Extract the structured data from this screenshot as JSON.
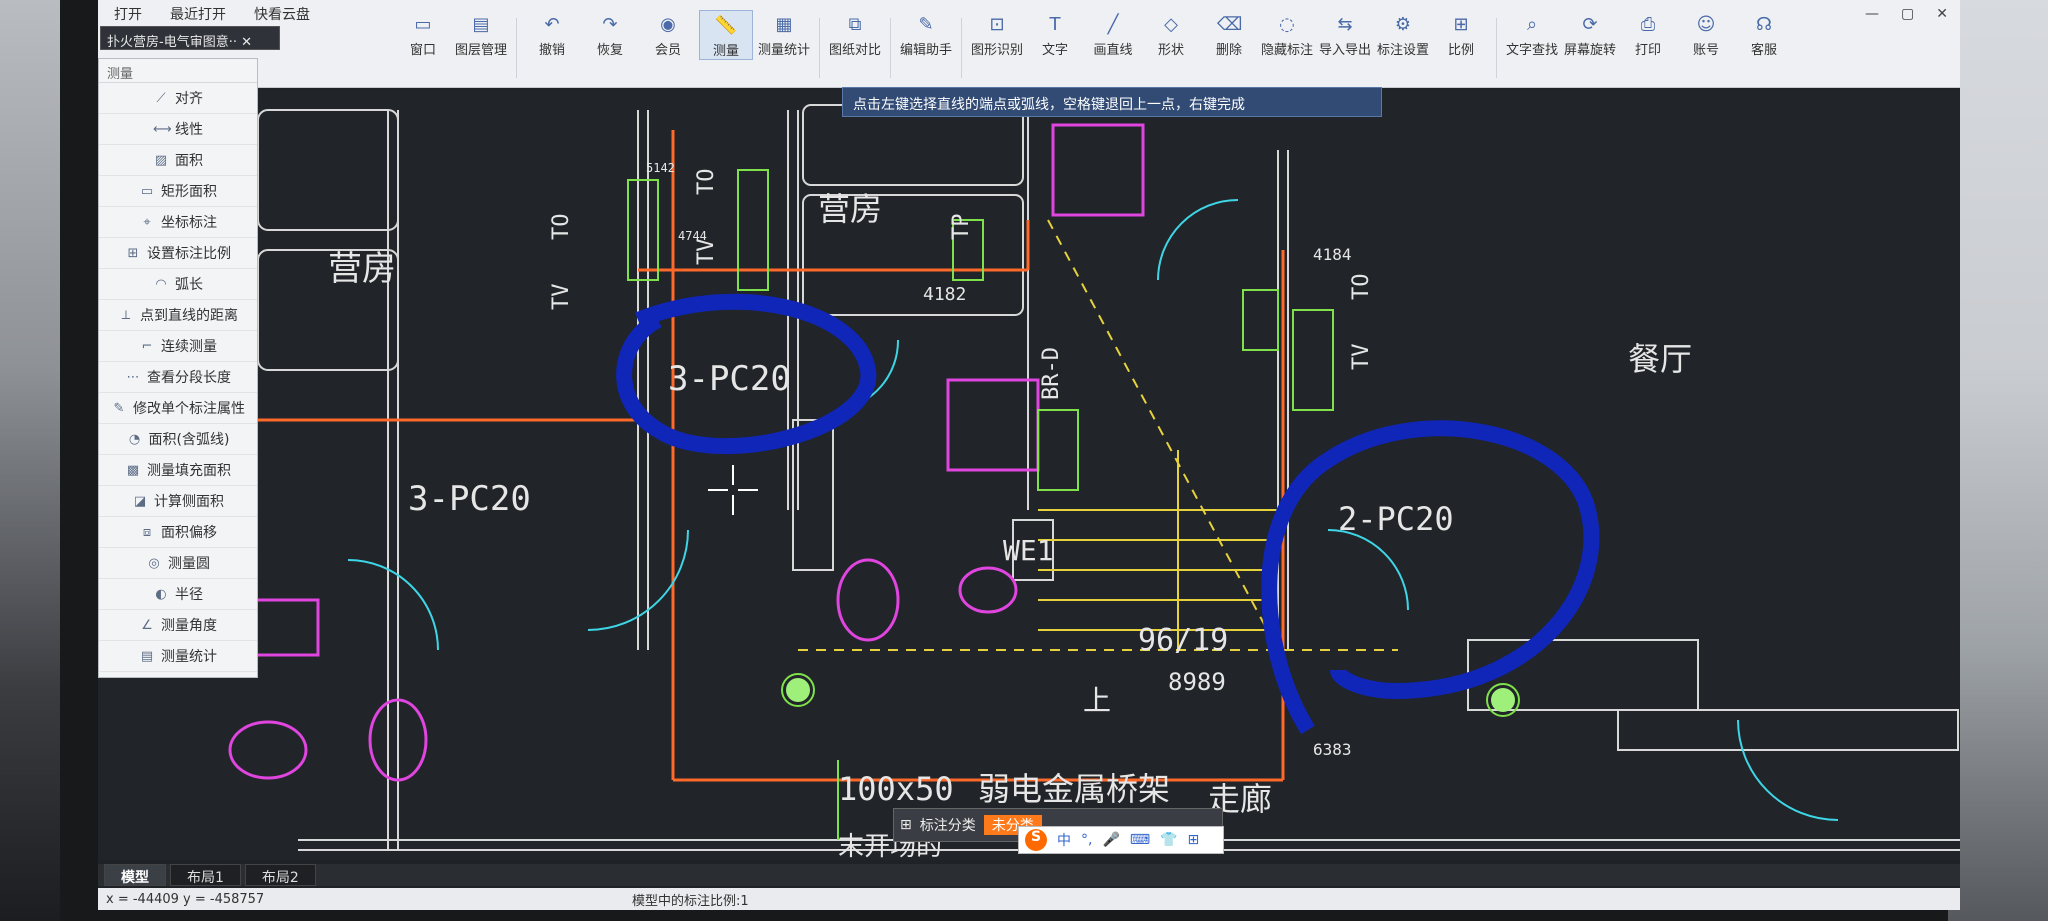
{
  "top_menu": [
    "打开",
    "最近打开",
    "快看云盘"
  ],
  "ribbon_buttons": [
    {
      "label": "窗口",
      "icon": "window-icon"
    },
    {
      "label": "图层管理",
      "icon": "layers-icon"
    },
    {
      "label": "撤销",
      "icon": "undo-icon"
    },
    {
      "label": "恢复",
      "icon": "redo-icon"
    },
    {
      "label": "会员",
      "icon": "vip-icon"
    },
    {
      "label": "测量",
      "icon": "ruler-icon"
    },
    {
      "label": "测量统计",
      "icon": "stats-icon"
    },
    {
      "label": "图纸对比",
      "icon": "compare-icon"
    },
    {
      "label": "编辑助手",
      "icon": "edit-assistant-icon"
    },
    {
      "label": "图形识别",
      "icon": "recognize-icon"
    },
    {
      "label": "文字",
      "icon": "text-icon"
    },
    {
      "label": "画直线",
      "icon": "line-icon"
    },
    {
      "label": "形状",
      "icon": "shape-icon"
    },
    {
      "label": "删除",
      "icon": "eraser-icon"
    },
    {
      "label": "隐藏标注",
      "icon": "hide-icon"
    },
    {
      "label": "导入导出",
      "icon": "import-export-icon"
    },
    {
      "label": "标注设置",
      "icon": "annotation-settings-icon"
    },
    {
      "label": "比例",
      "icon": "scale-icon"
    },
    {
      "label": "文字查找",
      "icon": "text-search-icon"
    },
    {
      "label": "屏幕旋转",
      "icon": "rotate-icon"
    },
    {
      "label": "打印",
      "icon": "print-icon"
    },
    {
      "label": "账号",
      "icon": "account-icon"
    },
    {
      "label": "客服",
      "icon": "support-icon"
    }
  ],
  "doc_tab": "扑火营房-电气审图意··",
  "tooltip": "点击左键选择直线的端点或弧线，空格键退回上一点，右键完成",
  "measure_panel": {
    "title": "测量",
    "items": [
      "对齐",
      "线性",
      "面积",
      "矩形面积",
      "坐标标注",
      "设置标注比例",
      "弧长",
      "点到直线的距离",
      "连续测量",
      "查看分段长度",
      "修改单个标注属性",
      "面积(含弧线)",
      "测量填充面积",
      "计算侧面积",
      "面积偏移",
      "测量圆",
      "半径",
      "测量角度",
      "测量统计"
    ]
  },
  "drawing_labels": {
    "room1": "营房",
    "room2": "营房",
    "dining": "餐厅",
    "corridor": "走廊",
    "circuit1": "3-PC20",
    "circuit2": "3-PC20",
    "circuit3": "2-PC20",
    "tray": "100x50",
    "tray_label": "弱电金属桥架",
    "we": "WE1",
    "up": "上",
    "br": "BR-D",
    "tp": "TP",
    "tv": "TV",
    "to": "TO",
    "stairs": "96/19",
    "elev": "8989",
    "dim1": "4182",
    "dim2": "6383",
    "dim3": "4184",
    "dim4": "5142",
    "dim5": "4744",
    "bottom_cut": "末开场的"
  },
  "layout_tabs": [
    "模型",
    "布局1",
    "布局2"
  ],
  "status": {
    "coords": "x = -44409 y = -458757",
    "scale": "模型中的标注比例:1"
  },
  "float_bar": {
    "label": "标注分类",
    "select": "未分类"
  },
  "ime": {
    "label": "中"
  }
}
